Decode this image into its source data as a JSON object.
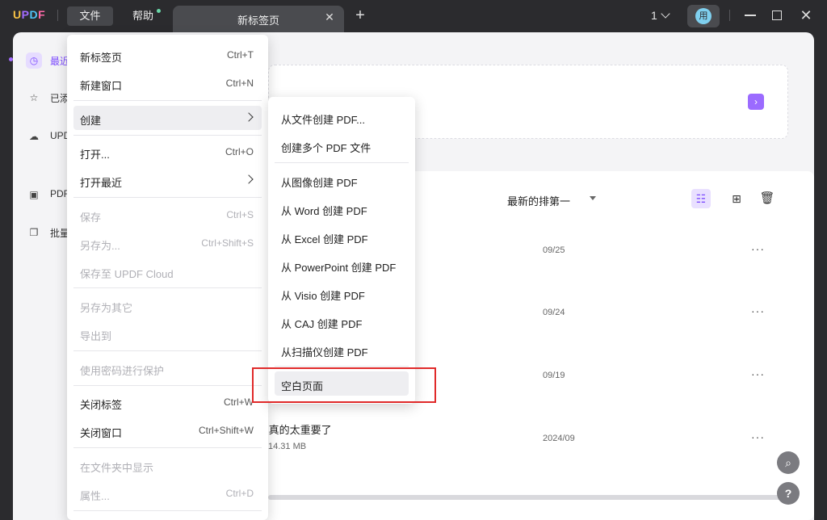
{
  "titlebar": {
    "logo": {
      "u": "U",
      "p": "P",
      "d": "D",
      "f": "F"
    },
    "menu_file": "文件",
    "menu_help": "帮助",
    "tab_label": "新标签页",
    "tab_close": "✕",
    "tab_add": "+",
    "page_count": "1",
    "avatar_text": "用",
    "close_glyph": "✕"
  },
  "sidebar": {
    "items": [
      {
        "label": "最近",
        "icon": "clock-icon",
        "glyph": "◷"
      },
      {
        "label": "已添",
        "icon": "star-icon",
        "glyph": "☆"
      },
      {
        "label": "UPD",
        "icon": "cloud-icon",
        "glyph": "☁"
      },
      {
        "label": "PDF",
        "icon": "briefcase-icon",
        "glyph": "▣"
      },
      {
        "label": "批量",
        "icon": "copy-icon",
        "glyph": "❐"
      }
    ]
  },
  "main": {
    "drop_arrow": "›",
    "sort_label": "最新的排第一",
    "view_list_glyph": "☷",
    "view_grid_glyph": "⊞",
    "trash_glyph": "🗑",
    "rows": [
      {
        "date": "09/25",
        "more": "···"
      },
      {
        "date": "09/24",
        "more": "···"
      },
      {
        "date": "09/19",
        "more": "···"
      },
      {
        "date": "2024/09",
        "more": "···"
      }
    ],
    "row4_title": "柔,真的太重要了",
    "row4_size": "14.31 MB",
    "search_glyph": "⌕",
    "help_glyph": "?"
  },
  "file_menu": {
    "items": [
      {
        "label": "新标签页",
        "shortcut": "Ctrl+T",
        "enabled": true
      },
      {
        "label": "新建窗口",
        "shortcut": "Ctrl+N",
        "enabled": true
      },
      {
        "label": "创建",
        "shortcut": "",
        "enabled": true,
        "submenu": true
      },
      {
        "label": "打开...",
        "shortcut": "Ctrl+O",
        "enabled": true
      },
      {
        "label": "打开最近",
        "shortcut": "",
        "enabled": true,
        "submenu": true
      },
      {
        "label": "保存",
        "shortcut": "Ctrl+S",
        "enabled": false
      },
      {
        "label": "另存为...",
        "shortcut": "Ctrl+Shift+S",
        "enabled": false
      },
      {
        "label": "保存至 UPDF Cloud",
        "shortcut": "",
        "enabled": false
      },
      {
        "label": "另存为其它",
        "shortcut": "",
        "enabled": false
      },
      {
        "label": "导出到",
        "shortcut": "",
        "enabled": false
      },
      {
        "label": "使用密码进行保护",
        "shortcut": "",
        "enabled": false
      },
      {
        "label": "关闭标签",
        "shortcut": "Ctrl+W",
        "enabled": true
      },
      {
        "label": "关闭窗口",
        "shortcut": "Ctrl+Shift+W",
        "enabled": true
      },
      {
        "label": "在文件夹中显示",
        "shortcut": "",
        "enabled": false
      },
      {
        "label": "属性...",
        "shortcut": "Ctrl+D",
        "enabled": false
      }
    ]
  },
  "create_submenu": {
    "items": [
      "从文件创建 PDF...",
      "创建多个 PDF 文件",
      "从图像创建 PDF",
      "从 Word 创建 PDF",
      "从 Excel 创建 PDF",
      "从 PowerPoint 创建 PDF",
      "从 Visio 创建 PDF",
      "从 CAJ 创建 PDF",
      "从扫描仪创建 PDF",
      "空白页面"
    ]
  },
  "colors": {
    "accent": "#7d4cff",
    "titlebar_bg": "#2b2b2e",
    "highlight_box": "#e02a2a"
  }
}
